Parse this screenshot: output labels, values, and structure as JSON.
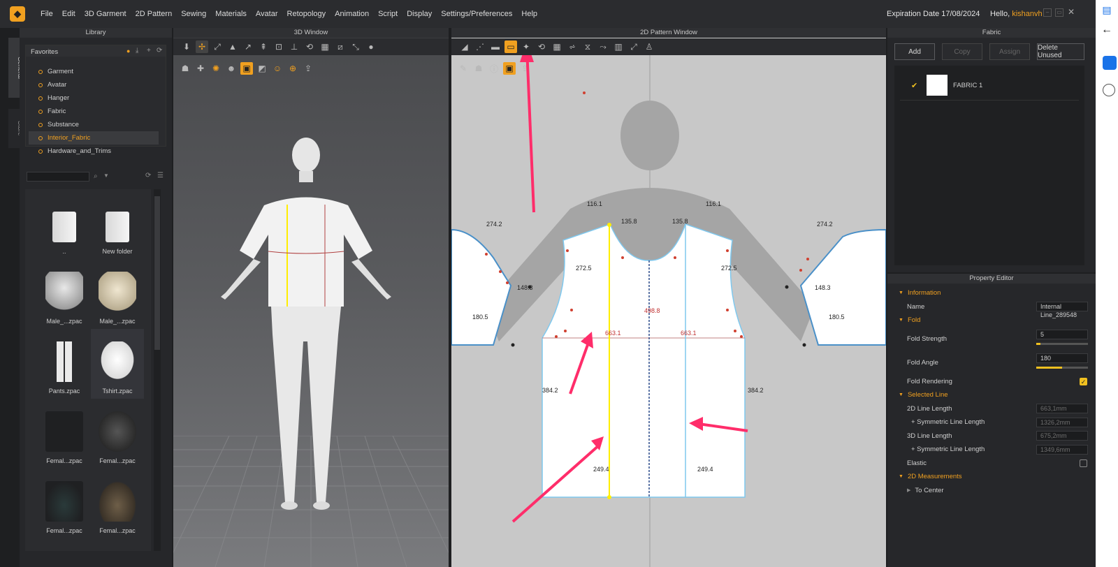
{
  "menubar": {
    "items": [
      "File",
      "Edit",
      "3D Garment",
      "2D Pattern",
      "Sewing",
      "Materials",
      "Avatar",
      "Retopology",
      "Animation",
      "Script",
      "Display",
      "Settings/Preferences",
      "Help"
    ],
    "expiration": "Expiration Date 17/08/2024",
    "hello_prefix": "Hello,",
    "username": "kishanvh"
  },
  "side_tabs": [
    "General",
    "Store"
  ],
  "library": {
    "title": "Library",
    "favorites_label": "Favorites",
    "favorites": [
      "Garment",
      "Avatar",
      "Hanger",
      "Fabric",
      "Substance",
      "Interior_Fabric",
      "Hardware_and_Trims"
    ],
    "selected_favorite": "Interior_Fabric",
    "search_placeholder": "",
    "items": [
      {
        "label": "..",
        "icon": "folder-icon"
      },
      {
        "label": "New folder",
        "icon": "folder-icon"
      },
      {
        "label": "Male_...zpac",
        "icon": "hoodie-icon"
      },
      {
        "label": "Male_...zpac",
        "icon": "jacket-icon"
      },
      {
        "label": "Pants.zpac",
        "icon": "pants-icon"
      },
      {
        "label": "Tshirt.zpac",
        "icon": "tshirt-icon"
      },
      {
        "label": "Femal...zpac",
        "icon": "dress-icon"
      },
      {
        "label": "Femal...zpac",
        "icon": "dress-icon"
      },
      {
        "label": "Femal...zpac",
        "icon": "skirt-icon"
      },
      {
        "label": "Femal...zpac",
        "icon": "skirt-icon"
      }
    ]
  },
  "window3d": {
    "title": "3D Window"
  },
  "window2d": {
    "title": "2D Pattern Window",
    "measurements": [
      "116.1",
      "135.8",
      "135.8",
      "116.1",
      "274.2",
      "274.2",
      "272.5",
      "272.5",
      "148.3",
      "148.3",
      "180.5",
      "180.5",
      "498.8",
      "663.1",
      "663.1",
      "384.2",
      "384.2",
      "249.4",
      "249.4"
    ]
  },
  "fabric": {
    "title": "Fabric",
    "buttons": {
      "add": "Add",
      "copy": "Copy",
      "assign": "Assign",
      "delete": "Delete Unused"
    },
    "items": [
      {
        "name": "FABRIC 1",
        "checked": true
      }
    ]
  },
  "property_editor": {
    "title": "Property Editor",
    "information_label": "Information",
    "name_label": "Name",
    "name_value": "Internal Line_289548",
    "fold_label": "Fold",
    "fold_strength_label": "Fold Strength",
    "fold_strength_value": "5",
    "fold_angle_label": "Fold Angle",
    "fold_angle_value": "180",
    "fold_rendering_label": "Fold Rendering",
    "fold_rendering": true,
    "selected_line_label": "Selected Line",
    "line2d_label": "2D Line Length",
    "line2d_value": "663,1mm",
    "sym2d_label": "+ Symmetric Line Length",
    "sym2d_value": "1326,2mm",
    "line3d_label": "3D Line Length",
    "line3d_value": "675,2mm",
    "sym3d_label": "+ Symmetric Line Length",
    "sym3d_value": "1349,6mm",
    "elastic_label": "Elastic",
    "elastic": false,
    "measurements_label": "2D Measurements",
    "to_center_label": "To Center"
  },
  "colors": {
    "accent": "#f0a020",
    "highlight_arrow": "#ff2d6a",
    "selected_line": "#ffee00",
    "pattern_edge": "#7fc8ee"
  }
}
